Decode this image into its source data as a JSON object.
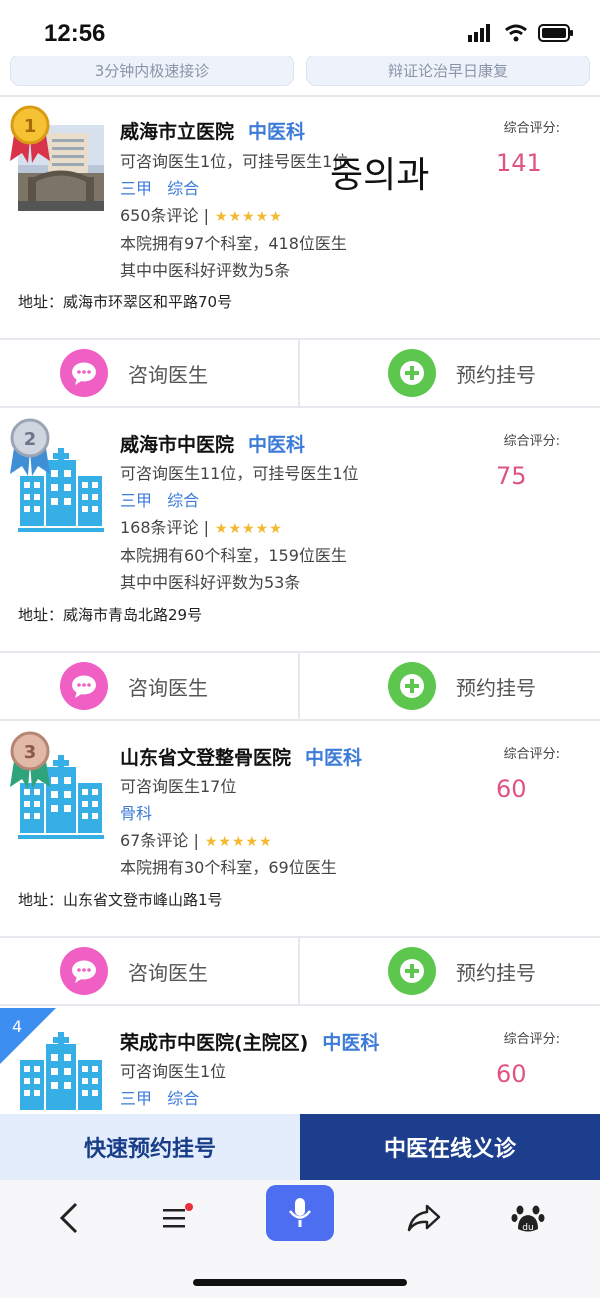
{
  "status_bar": {
    "time": "12:56"
  },
  "top_pills": {
    "left": "3分钟内极速接诊",
    "right": "辩证论治早日康复"
  },
  "overlay_text": "중의과",
  "common": {
    "score_label": "综合评分:",
    "consult_label": "咨询医生",
    "appoint_label": "预约挂号",
    "stars": "★★★★★"
  },
  "hospitals": [
    {
      "rank": "1",
      "name": "威海市立医院",
      "dept": "中医科",
      "doctors": "可咨询医生1位，可挂号医生1位",
      "level": "三甲",
      "type": "综合",
      "reviews": "650条评论",
      "dept_info": "本院拥有97个科室，418位医生",
      "good_reviews": "其中中医科好评数为5条",
      "address": "地址：威海市环翠区和平路70号",
      "score": "141"
    },
    {
      "rank": "2",
      "name": "威海市中医院",
      "dept": "中医科",
      "doctors": "可咨询医生11位，可挂号医生1位",
      "level": "三甲",
      "type": "综合",
      "reviews": "168条评论",
      "dept_info": "本院拥有60个科室，159位医生",
      "good_reviews": "其中中医科好评数为53条",
      "address": "地址：威海市青岛北路29号",
      "score": "75"
    },
    {
      "rank": "3",
      "name": "山东省文登整骨医院",
      "dept": "中医科",
      "doctors": "可咨询医生17位",
      "level": "骨科",
      "reviews": "67条评论",
      "dept_info": "本院拥有30个科室，69位医生",
      "address": "地址：山东省文登市峰山路1号",
      "score": "60"
    },
    {
      "rank": "4",
      "name": "荣成市中医院(主院区)",
      "dept": "中医科",
      "doctors": "可咨询医生1位",
      "level": "三甲",
      "type": "综合",
      "score": "60"
    }
  ],
  "bottom_tabs": {
    "left": "快速预约挂号",
    "right": "中医在线义诊"
  },
  "colors": {
    "accent_blue": "#3d7bd9",
    "score_pink": "#e05384",
    "nav_blue": "#1d3e8c",
    "mic_blue": "#4e6ef2"
  }
}
